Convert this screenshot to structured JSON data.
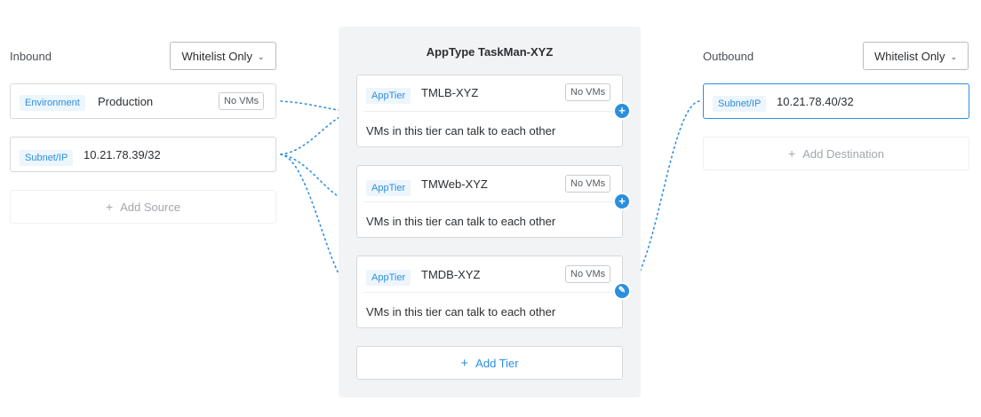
{
  "inbound": {
    "title": "Inbound",
    "dropdown": "Whitelist Only",
    "sources": [
      {
        "tag": "Environment",
        "value": "Production",
        "badge": "No VMs"
      },
      {
        "tag": "Subnet/IP",
        "value": "10.21.78.39/32"
      }
    ],
    "add_label": "Add Source"
  },
  "apptype": {
    "title": "AppType TaskMan-XYZ",
    "tiers": [
      {
        "tag": "AppTier",
        "name": "TMLB-XYZ",
        "badge": "No VMs",
        "desc": "VMs in this tier can talk to each other"
      },
      {
        "tag": "AppTier",
        "name": "TMWeb-XYZ",
        "badge": "No VMs",
        "desc": "VMs in this tier can talk to each other"
      },
      {
        "tag": "AppTier",
        "name": "TMDB-XYZ",
        "badge": "No VMs",
        "desc": "VMs in this tier can talk to each other"
      }
    ],
    "add_tier_label": "Add Tier"
  },
  "outbound": {
    "title": "Outbound",
    "dropdown": "Whitelist Only",
    "destinations": [
      {
        "tag": "Subnet/IP",
        "value": "10.21.78.40/32"
      }
    ],
    "add_label": "Add Destination"
  },
  "colors": {
    "accent": "#2b8fe0",
    "panel": "#f2f3f4",
    "border": "#d6d9dc"
  },
  "icons": {
    "dropdown": "chevron-down-icon",
    "add": "plus-icon",
    "edit": "pencil-icon"
  }
}
